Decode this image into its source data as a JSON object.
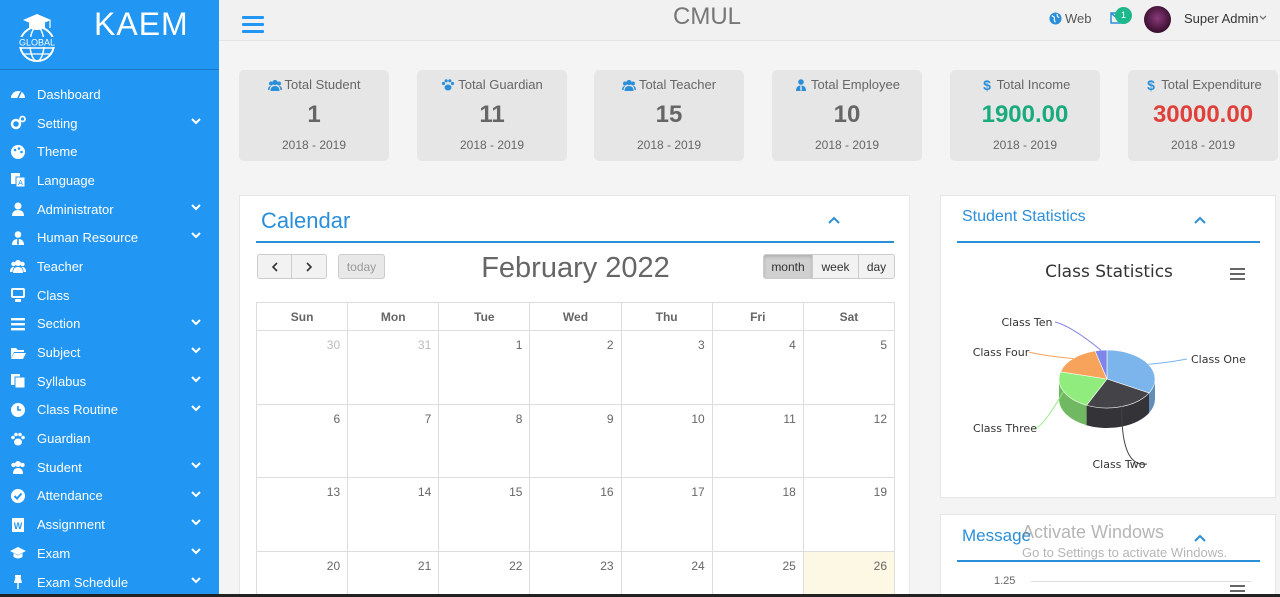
{
  "brand": {
    "name": "KAEM",
    "logo_text": "GLOBAL"
  },
  "sidebar": {
    "items": [
      {
        "label": "Dashboard",
        "icon": "dashboard-icon",
        "has_submenu": false
      },
      {
        "label": "Setting",
        "icon": "cogs-icon",
        "has_submenu": true
      },
      {
        "label": "Theme",
        "icon": "paint-icon",
        "has_submenu": false
      },
      {
        "label": "Language",
        "icon": "language-icon",
        "has_submenu": false
      },
      {
        "label": "Administrator",
        "icon": "user-icon",
        "has_submenu": true
      },
      {
        "label": "Human Resource",
        "icon": "user-tie-icon",
        "has_submenu": true
      },
      {
        "label": "Teacher",
        "icon": "users-icon",
        "has_submenu": false
      },
      {
        "label": "Class",
        "icon": "blackboard-icon",
        "has_submenu": false
      },
      {
        "label": "Section",
        "icon": "bars-icon",
        "has_submenu": true
      },
      {
        "label": "Subject",
        "icon": "folder-open-icon",
        "has_submenu": true
      },
      {
        "label": "Syllabus",
        "icon": "files-icon",
        "has_submenu": true
      },
      {
        "label": "Class Routine",
        "icon": "clock-icon",
        "has_submenu": true
      },
      {
        "label": "Guardian",
        "icon": "paw-icon",
        "has_submenu": false
      },
      {
        "label": "Student",
        "icon": "group-icon",
        "has_submenu": true
      },
      {
        "label": "Attendance",
        "icon": "check-circle-icon",
        "has_submenu": true
      },
      {
        "label": "Assignment",
        "icon": "word-file-icon",
        "has_submenu": true
      },
      {
        "label": "Exam",
        "icon": "graduation-cap-icon",
        "has_submenu": true
      },
      {
        "label": "Exam Schedule",
        "icon": "pin-icon",
        "has_submenu": true
      }
    ]
  },
  "topbar": {
    "title": "CMUL",
    "web_label": "Web",
    "mail_count": "1",
    "user_name": "Super Admin"
  },
  "cards": [
    {
      "label": "Total Student",
      "value": "1",
      "year": "2018 - 2019",
      "icon": "users-icon",
      "color": "#666666"
    },
    {
      "label": "Total Guardian",
      "value": "11",
      "year": "2018 - 2019",
      "icon": "paw-icon",
      "color": "#666666"
    },
    {
      "label": "Total Teacher",
      "value": "15",
      "year": "2018 - 2019",
      "icon": "users-icon",
      "color": "#666666"
    },
    {
      "label": "Total Employee",
      "value": "10",
      "year": "2018 - 2019",
      "icon": "user-tie-icon",
      "color": "#666666"
    },
    {
      "label": "Total Income",
      "value": "1900.00",
      "year": "2018 - 2019",
      "icon": "dollar-icon",
      "color": "#1aab7d"
    },
    {
      "label": "Total Expenditure",
      "value": "30000.00",
      "year": "2018 - 2019",
      "icon": "dollar-icon",
      "color": "#e0403a"
    }
  ],
  "calendar": {
    "title": "Calendar",
    "month_label": "February 2022",
    "today_label": "today",
    "views": {
      "month": "month",
      "week": "week",
      "day": "day"
    },
    "active_view": "month",
    "weekdays": [
      "Sun",
      "Mon",
      "Tue",
      "Wed",
      "Thu",
      "Fri",
      "Sat"
    ],
    "weeks": [
      [
        "30",
        "31",
        "1",
        "2",
        "3",
        "4",
        "5"
      ],
      [
        "6",
        "7",
        "8",
        "9",
        "10",
        "11",
        "12"
      ],
      [
        "13",
        "14",
        "15",
        "16",
        "17",
        "18",
        "19"
      ],
      [
        "20",
        "21",
        "22",
        "23",
        "24",
        "25",
        "26"
      ]
    ],
    "muted_days": [
      "30",
      "31"
    ],
    "highlight_day": "26"
  },
  "student_stats": {
    "title": "Student Statistics",
    "chart_data": {
      "type": "pie",
      "title": "Class Statistics",
      "categories": [
        "Class One",
        "Class Two",
        "Class Three",
        "Class Four",
        "Class Ten"
      ],
      "values": [
        33,
        24,
        22,
        17,
        4
      ],
      "colors": [
        "#7cb5ec",
        "#434348",
        "#90ed7d",
        "#f7a35c",
        "#8085e9"
      ],
      "three_d": true
    }
  },
  "message": {
    "title": "Message",
    "y_tick": "1.25"
  },
  "watermark": {
    "line1": "Activate Windows",
    "line2": "Go to Settings to activate Windows."
  }
}
